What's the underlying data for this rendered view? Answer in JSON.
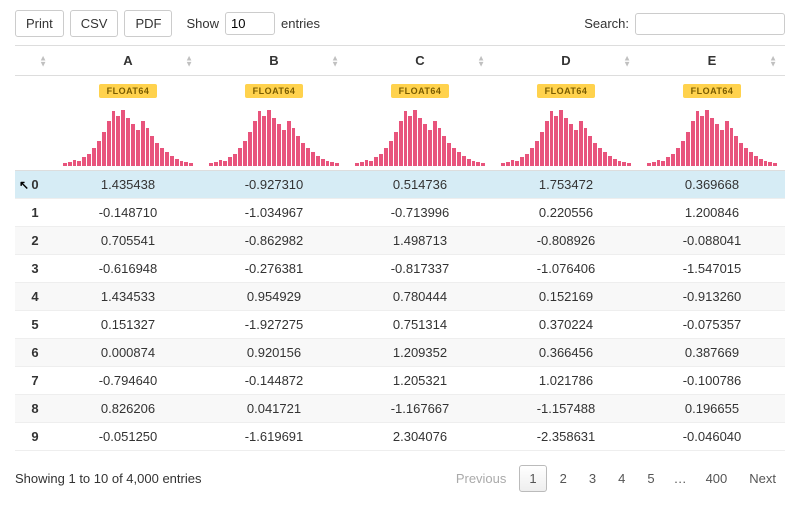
{
  "toolbar": {
    "print": "Print",
    "csv": "CSV",
    "pdf": "PDF",
    "show_label": "Show",
    "entries_label": "entries",
    "page_length": "10",
    "search_label": "Search:",
    "search_value": ""
  },
  "columns": [
    "A",
    "B",
    "C",
    "D",
    "E"
  ],
  "dtype_badge": "FLOAT64",
  "hist_bars": [
    3,
    4,
    6,
    5,
    9,
    12,
    18,
    25,
    34,
    45,
    55,
    50,
    56,
    48,
    42,
    36,
    45,
    38,
    30,
    23,
    18,
    14,
    10,
    7,
    5,
    4,
    3
  ],
  "rows": [
    {
      "idx": "0",
      "cells": [
        "1.435438",
        "-0.927310",
        "0.514736",
        "1.753472",
        "0.369668"
      ]
    },
    {
      "idx": "1",
      "cells": [
        "-0.148710",
        "-1.034967",
        "-0.713996",
        "0.220556",
        "1.200846"
      ]
    },
    {
      "idx": "2",
      "cells": [
        "0.705541",
        "-0.862982",
        "1.498713",
        "-0.808926",
        "-0.088041"
      ]
    },
    {
      "idx": "3",
      "cells": [
        "-0.616948",
        "-0.276381",
        "-0.817337",
        "-1.076406",
        "-1.547015"
      ]
    },
    {
      "idx": "4",
      "cells": [
        "1.434533",
        "0.954929",
        "0.780444",
        "0.152169",
        "-0.913260"
      ]
    },
    {
      "idx": "5",
      "cells": [
        "0.151327",
        "-1.927275",
        "0.751314",
        "0.370224",
        "-0.075357"
      ]
    },
    {
      "idx": "6",
      "cells": [
        "0.000874",
        "0.920156",
        "1.209352",
        "0.366456",
        "0.387669"
      ]
    },
    {
      "idx": "7",
      "cells": [
        "-0.794640",
        "-0.144872",
        "1.205321",
        "1.021786",
        "-0.100786"
      ]
    },
    {
      "idx": "8",
      "cells": [
        "0.826206",
        "0.041721",
        "-1.167667",
        "-1.157488",
        "0.196655"
      ]
    },
    {
      "idx": "9",
      "cells": [
        "-0.051250",
        "-1.619691",
        "2.304076",
        "-2.358631",
        "-0.046040"
      ]
    }
  ],
  "footer": {
    "info": "Showing 1 to 10 of 4,000 entries",
    "previous": "Previous",
    "next": "Next",
    "pages": [
      "1",
      "2",
      "3",
      "4",
      "5"
    ],
    "ellipsis": "…",
    "last_page": "400"
  }
}
